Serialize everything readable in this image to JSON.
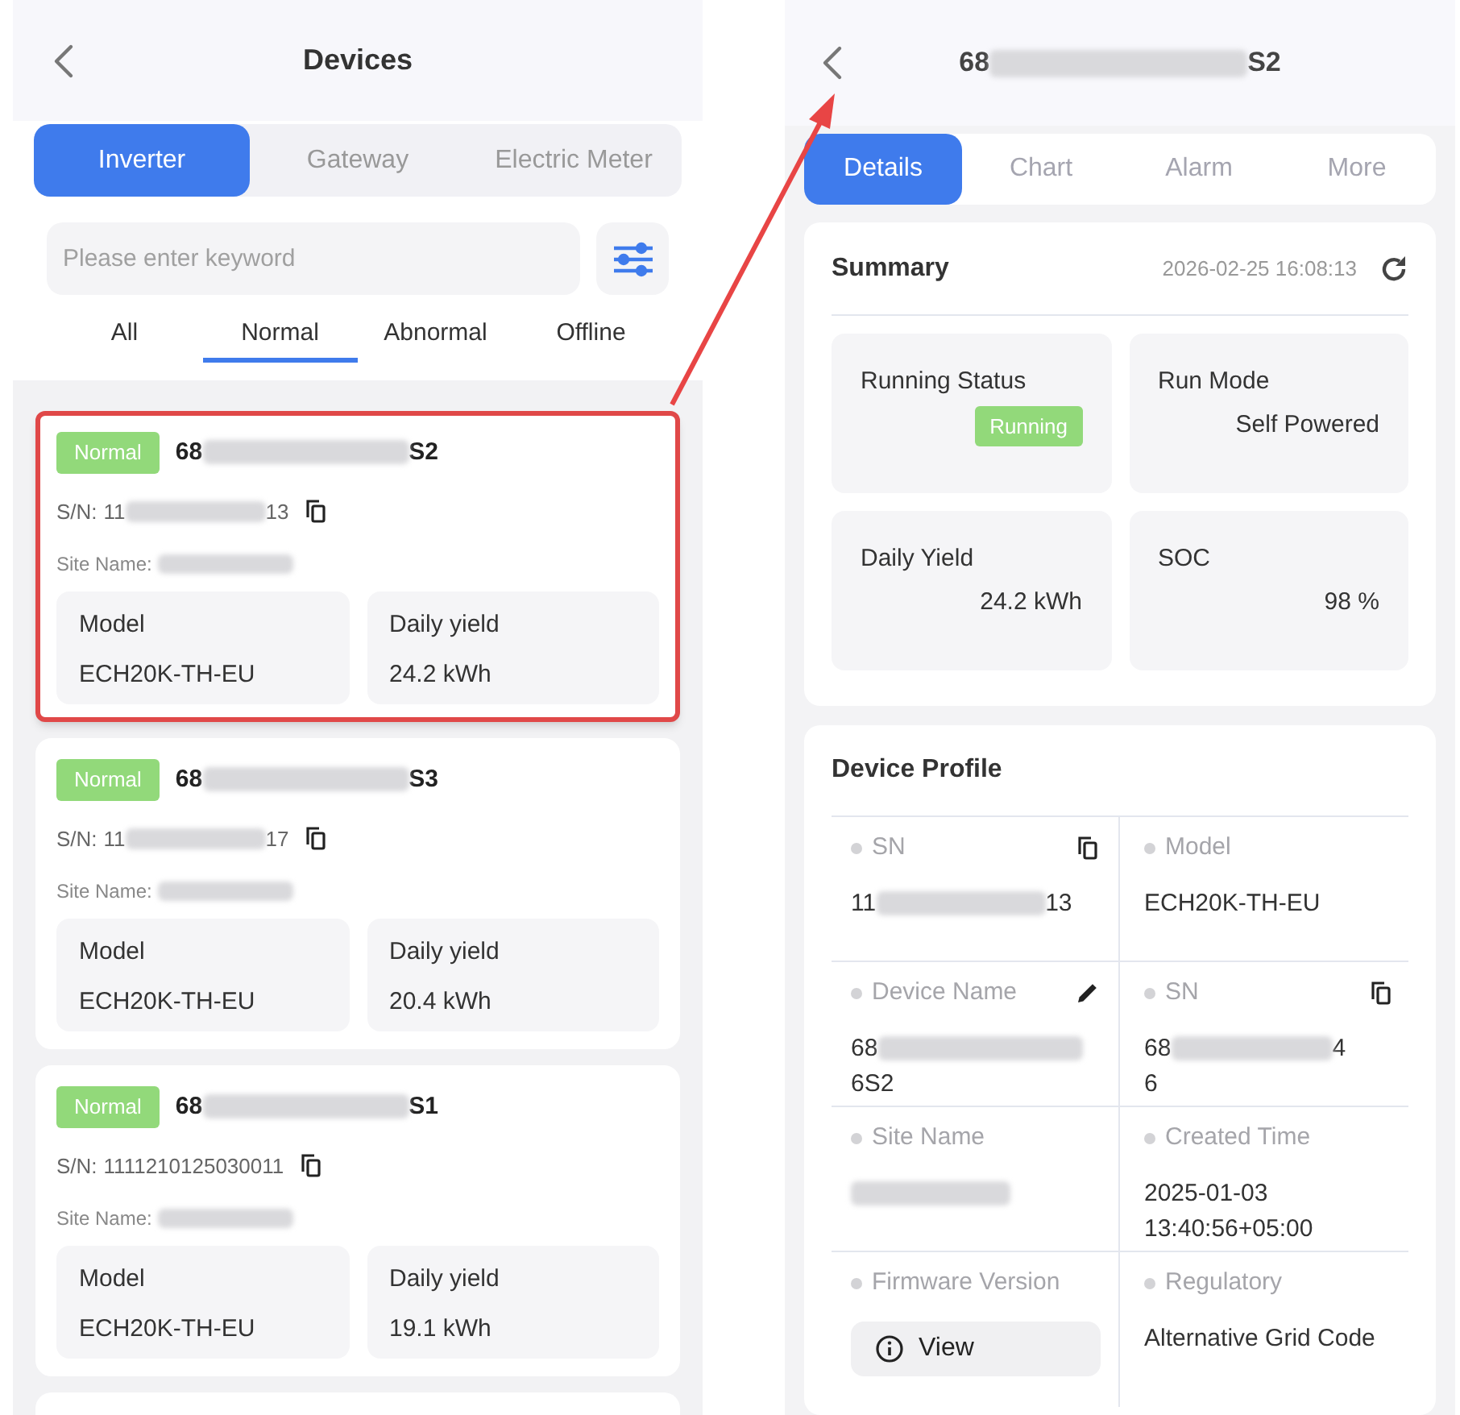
{
  "left": {
    "title": "Devices",
    "device_types": [
      {
        "label": "Inverter",
        "selected": true
      },
      {
        "label": "Gateway",
        "selected": false
      },
      {
        "label": "Electric Meter",
        "selected": false
      }
    ],
    "search": {
      "placeholder": "Please enter keyword"
    },
    "status_filters": [
      {
        "label": "All",
        "selected": false
      },
      {
        "label": "Normal",
        "selected": true
      },
      {
        "label": "Abnormal",
        "selected": false
      },
      {
        "label": "Offline",
        "selected": false
      }
    ],
    "devices": [
      {
        "status": "Normal",
        "name_start": "68",
        "name_end": "S2",
        "sn_label": "S/N:",
        "sn_start": "11",
        "sn_end": "13",
        "site_label": "Site Name:",
        "highlighted": true,
        "model_label": "Model",
        "model": "ECH20K-TH-EU",
        "yield_label": "Daily yield",
        "yield": "24.2 kWh"
      },
      {
        "status": "Normal",
        "name_start": "68",
        "name_end": "S3",
        "sn_label": "S/N:",
        "sn_start": "11",
        "sn_end": "17",
        "site_label": "Site Name:",
        "highlighted": false,
        "model_label": "Model",
        "model": "ECH20K-TH-EU",
        "yield_label": "Daily yield",
        "yield": "20.4 kWh"
      },
      {
        "status": "Normal",
        "name_start": "68",
        "name_end": "S1",
        "sn_label": "S/N:",
        "sn_start": "1111210125030011",
        "site_label": "Site Name:",
        "highlighted": false,
        "model_label": "Model",
        "model": "ECH20K-TH-EU",
        "yield_label": "Daily yield",
        "yield": "19.1 kWh"
      }
    ]
  },
  "right": {
    "title_start": "68",
    "title_end": "S2",
    "tabs": [
      {
        "label": "Details",
        "selected": true
      },
      {
        "label": "Chart",
        "selected": false
      },
      {
        "label": "Alarm",
        "selected": false
      },
      {
        "label": "More",
        "selected": false
      }
    ],
    "summary": {
      "title": "Summary",
      "timestamp": "2026-02-25 16:08:13",
      "tiles": [
        {
          "kind": "badge",
          "label": "Running Status",
          "value": "Running"
        },
        {
          "kind": "text",
          "label": "Run Mode",
          "value": "Self Powered"
        },
        {
          "kind": "text",
          "label": "Daily Yield",
          "value": "24.2 kWh"
        },
        {
          "kind": "text",
          "label": "SOC",
          "value": "98 %"
        }
      ]
    },
    "profile": {
      "title": "Device Profile",
      "fields": [
        {
          "label": "SN",
          "kind": "masked",
          "start": "11",
          "end": "13",
          "copyable": true
        },
        {
          "label": "Model",
          "kind": "text",
          "value": "ECH20K-TH-EU"
        },
        {
          "label": "Device Name",
          "kind": "masked",
          "start": "68",
          "end": "6S2",
          "editable": true
        },
        {
          "label": "SN",
          "kind": "masked",
          "start": "68",
          "end": "6",
          "mid_end": "4",
          "copyable": true
        },
        {
          "label": "Site Name",
          "kind": "hidden"
        },
        {
          "label": "Created Time",
          "kind": "text",
          "value": "2025-01-03 13:40:56+05:00"
        },
        {
          "label": "Firmware Version",
          "kind": "button",
          "value": "View"
        },
        {
          "label": "Regulatory",
          "kind": "text",
          "value": "Alternative Grid Code"
        }
      ]
    }
  }
}
